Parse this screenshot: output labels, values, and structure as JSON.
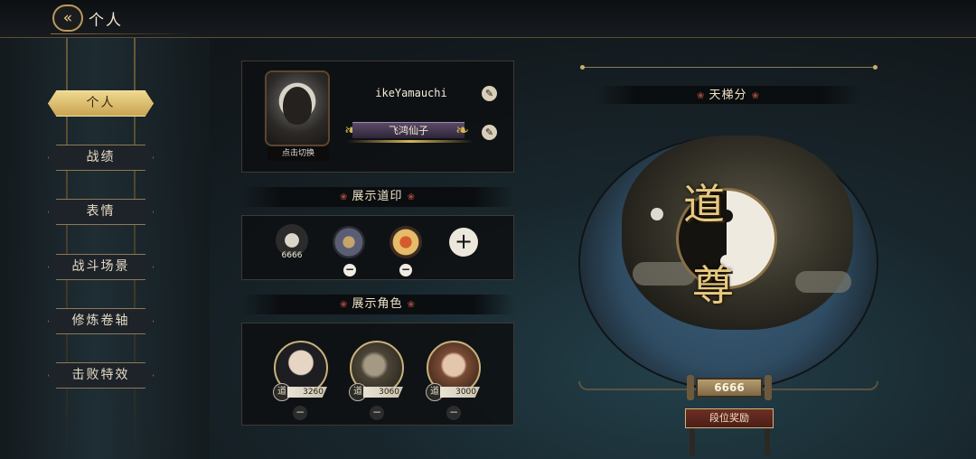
{
  "header": {
    "title": "个人",
    "back_icon": "double-arrow-back-icon"
  },
  "sidebar": {
    "items": [
      {
        "label": "个人",
        "active": true
      },
      {
        "label": "战绩",
        "active": false
      },
      {
        "label": "表情",
        "active": false
      },
      {
        "label": "战斗场景",
        "active": false
      },
      {
        "label": "修炼卷轴",
        "active": false
      },
      {
        "label": "击败特效",
        "active": false
      }
    ]
  },
  "profile": {
    "avatar_caption": "点击切换",
    "username": "ikeYamauchi",
    "player_title": "飞鸿仙子",
    "edit_icon": "brush-edit-icon"
  },
  "seals": {
    "header": "展示道印",
    "items": [
      {
        "icon": "crane-seal-icon",
        "caption": "6666",
        "removable": false
      },
      {
        "icon": "sword-shield-seal-icon",
        "caption": "",
        "removable": true
      },
      {
        "icon": "lantern-seal-icon",
        "caption": "",
        "removable": true
      }
    ],
    "add_label": "+",
    "remove_label": "−"
  },
  "characters": {
    "header": "展示角色",
    "items": [
      {
        "portrait": "female-cultivator-portrait",
        "rank_glyph": "道",
        "score": "3260"
      },
      {
        "portrait": "beast-warrior-portrait",
        "rank_glyph": "道",
        "score": "3060"
      },
      {
        "portrait": "flower-maiden-portrait",
        "rank_glyph": "道",
        "score": "3000"
      }
    ],
    "remove_label": "−"
  },
  "ladder": {
    "header": "天梯分",
    "rank_glyph_top": "道",
    "rank_glyph_bottom": "尊",
    "score": "6666",
    "reward_label": "段位奖励"
  },
  "colors": {
    "accent_gold": "#c9a453",
    "panel_bg": "#0e1012",
    "ornament_red": "#a44a3c"
  }
}
